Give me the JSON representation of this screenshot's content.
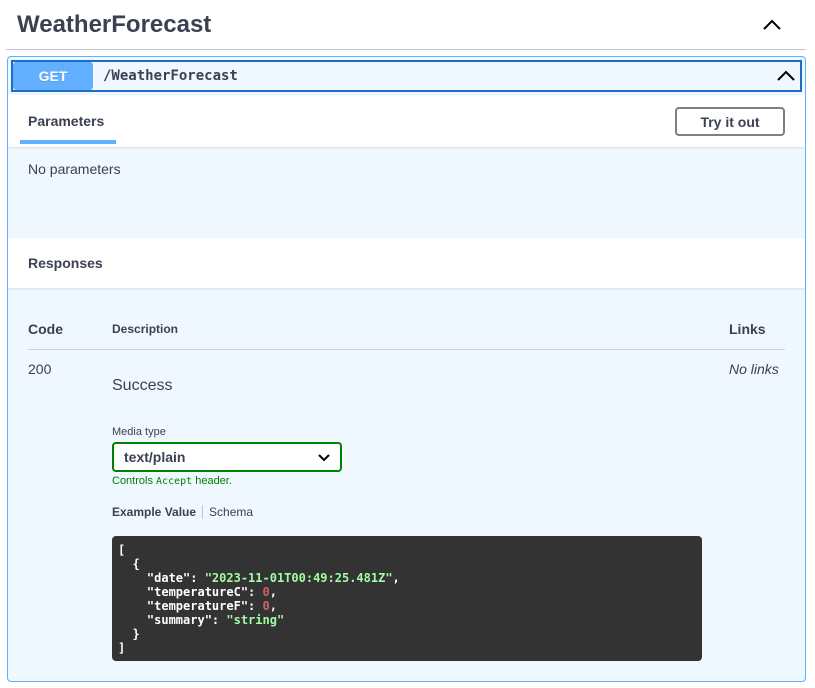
{
  "tag": {
    "title": "WeatherForecast"
  },
  "operation": {
    "method": "GET",
    "path": "/WeatherForecast"
  },
  "parameters": {
    "tab_label": "Parameters",
    "try_button": "Try it out",
    "empty_text": "No parameters"
  },
  "responses": {
    "title": "Responses",
    "columns": {
      "code": "Code",
      "description": "Description",
      "links": "Links"
    },
    "rows": [
      {
        "code": "200",
        "description": "Success",
        "links": "No links",
        "media_type_label": "Media type",
        "media_type_value": "text/plain",
        "controls_prefix": "Controls ",
        "controls_mono": "Accept",
        "controls_suffix": " header.",
        "tab_example": "Example Value",
        "tab_schema": "Schema",
        "example": {
          "date": "\"2023-11-01T00:49:25.481Z\"",
          "temperatureC": "0",
          "temperatureF": "0",
          "summary": "\"string\""
        }
      }
    ]
  },
  "icons": {
    "tag_toggle": "chevron-up-icon",
    "summary_toggle": "chevron-up-icon",
    "select_arrow": "chevron-down-icon"
  },
  "colors": {
    "get_method": "#61affe",
    "get_border": "#1d6ec2",
    "select_border": "#008000",
    "code_bg": "#333333",
    "json_string": "#a2fca2",
    "json_number": "#d36363"
  }
}
